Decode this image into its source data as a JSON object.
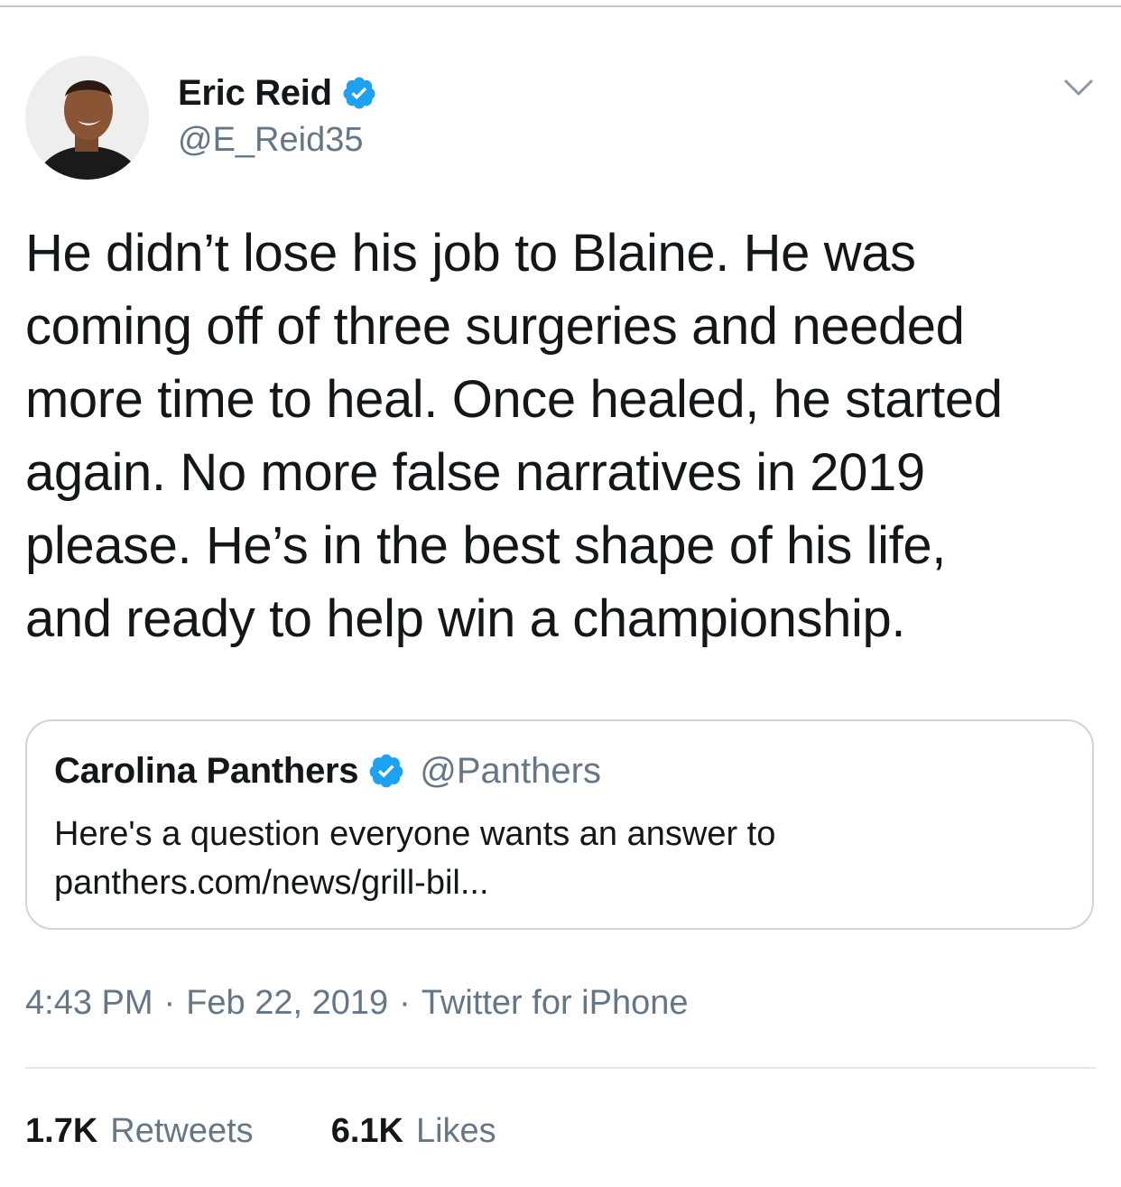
{
  "author": {
    "display_name": "Eric Reid",
    "handle": "@E_Reid35",
    "verified": true
  },
  "tweet": {
    "text": "He didn’t lose his job to Blaine. He was\ncoming off of three surgeries and needed\nmore time to heal. Once healed, he started\nagain. No more false narratives in 2019\nplease. He’s in the best shape of his life,\nand ready to help win a championship."
  },
  "quoted_tweet": {
    "display_name": "Carolina Panthers",
    "handle": "@Panthers",
    "verified": true,
    "text_line1": "Here's a question everyone wants an answer to",
    "text_line2": "panthers.com/news/grill-bil..."
  },
  "meta": {
    "time": "4:43 PM",
    "separator": "·",
    "date": "Feb 22, 2019",
    "source": "Twitter for iPhone"
  },
  "stats": {
    "retweets_count": "1.7K",
    "retweets_label": "Retweets",
    "likes_count": "6.1K",
    "likes_label": "Likes"
  },
  "icons": {
    "verified": "verified-badge-icon",
    "more": "chevron-down-icon"
  },
  "colors": {
    "verified_blue": "#1da1f2",
    "secondary_text": "#657786",
    "primary_text": "#14171a"
  }
}
